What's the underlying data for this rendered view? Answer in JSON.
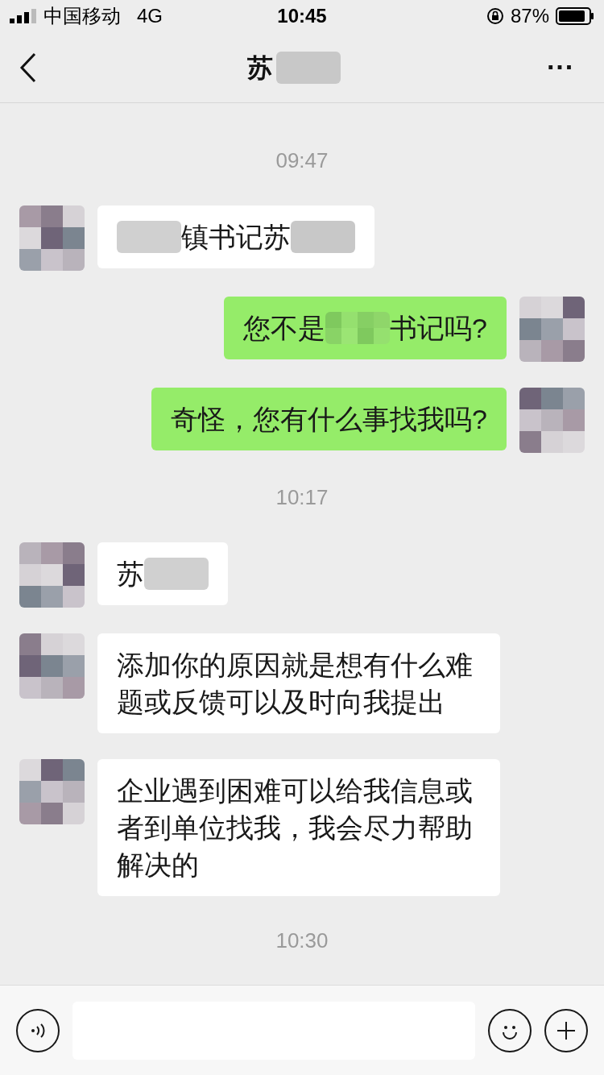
{
  "status_bar": {
    "carrier": "中国移动",
    "network": "4G",
    "time": "10:45",
    "battery": "87%"
  },
  "nav": {
    "title": "苏",
    "more": "···"
  },
  "messages": [
    {
      "kind": "time",
      "text": "09:47"
    },
    {
      "kind": "in",
      "parts": [
        {
          "kind": "mosaic"
        },
        {
          "kind": "text",
          "text": "镇书记苏"
        },
        {
          "kind": "mosaic"
        }
      ]
    },
    {
      "kind": "out",
      "parts": [
        {
          "kind": "text",
          "text": "您不是"
        },
        {
          "kind": "mosaic"
        },
        {
          "kind": "text",
          "text": "书记吗?"
        }
      ]
    },
    {
      "kind": "out",
      "parts": [
        {
          "kind": "text",
          "text": "奇怪，您有什么事找我吗?"
        }
      ]
    },
    {
      "kind": "time",
      "text": "10:17"
    },
    {
      "kind": "in",
      "parts": [
        {
          "kind": "text",
          "text": "苏"
        },
        {
          "kind": "mosaic"
        }
      ]
    },
    {
      "kind": "in",
      "parts": [
        {
          "kind": "text",
          "text": "添加你的原因就是想有什么难题或反馈可以及时向我提出"
        }
      ]
    },
    {
      "kind": "in",
      "parts": [
        {
          "kind": "text",
          "text": "企业遇到困难可以给我信息或者到单位找我，我会尽力帮助解决的"
        }
      ]
    },
    {
      "kind": "time",
      "text": "10:30"
    }
  ]
}
